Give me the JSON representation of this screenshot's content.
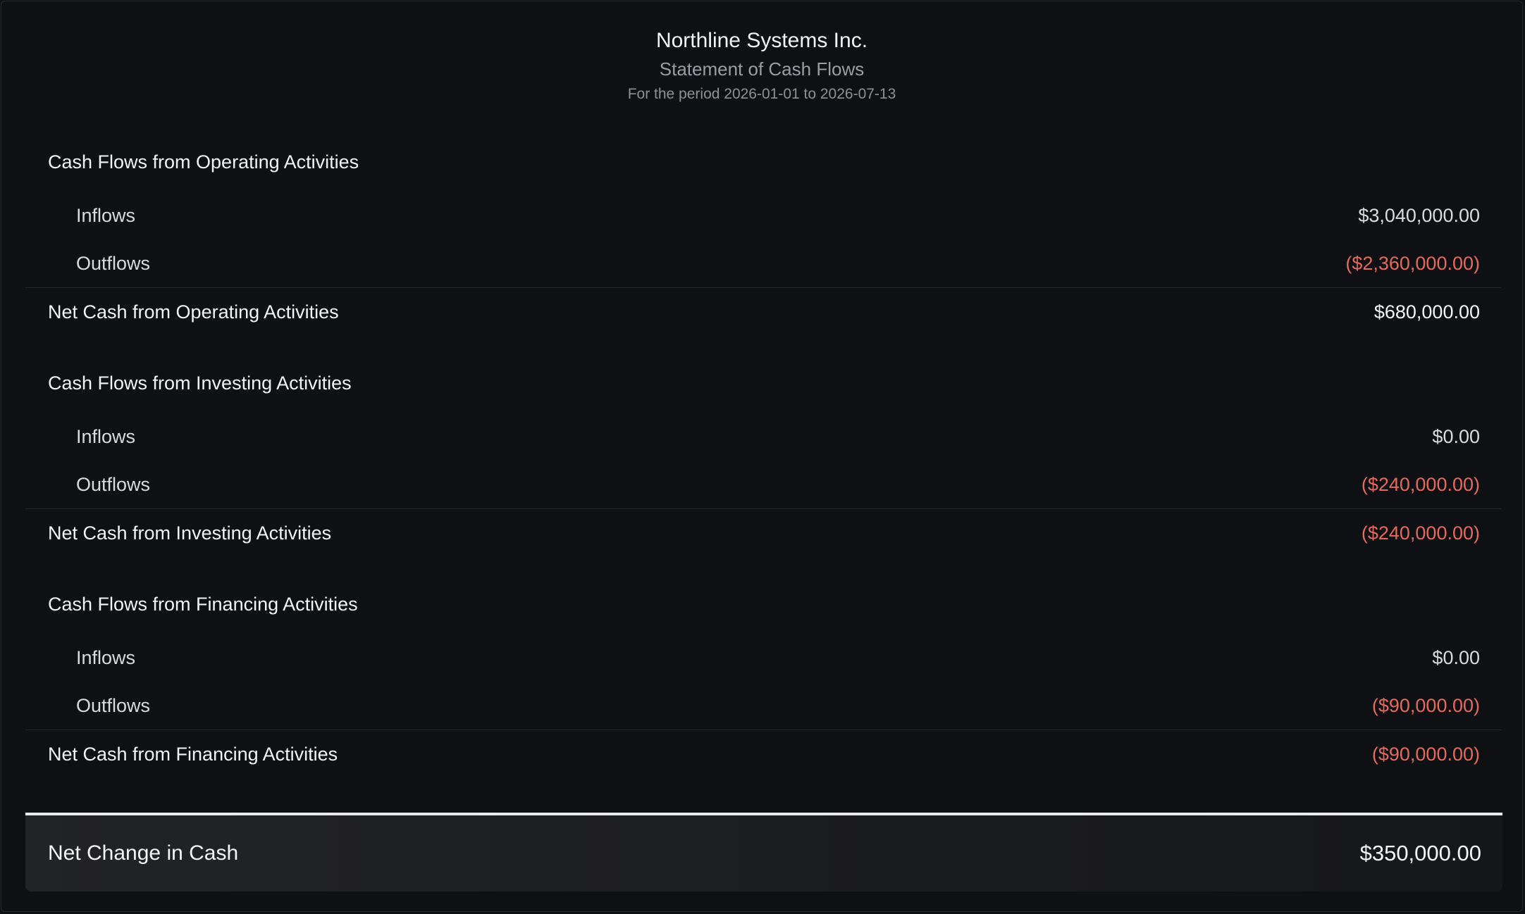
{
  "header": {
    "company": "Northline Systems Inc.",
    "title": "Statement of Cash Flows",
    "period": "For the period 2026-01-01 to 2026-07-13"
  },
  "sections": [
    {
      "title": "Cash Flows from Operating Activities",
      "inflows_label": "Inflows",
      "inflows": "$3,040,000.00",
      "outflows_label": "Outflows",
      "outflows": "($2,360,000.00)",
      "net_label": "Net Cash from Operating Activities",
      "net": "$680,000.00"
    },
    {
      "title": "Cash Flows from Investing Activities",
      "inflows_label": "Inflows",
      "inflows": "$0.00",
      "outflows_label": "Outflows",
      "outflows": "($240,000.00)",
      "net_label": "Net Cash from Investing Activities",
      "net": "($240,000.00)"
    },
    {
      "title": "Cash Flows from Financing Activities",
      "inflows_label": "Inflows",
      "inflows": "$0.00",
      "outflows_label": "Outflows",
      "outflows": "($90,000.00)",
      "net_label": "Net Cash from Financing Activities",
      "net": "($90,000.00)"
    }
  ],
  "total": {
    "label": "Net Change in Cash",
    "amount": "$350,000.00"
  },
  "colors": {
    "negative": "#e46a5c",
    "background": "#0f1013",
    "text": "#e6e7ea"
  }
}
